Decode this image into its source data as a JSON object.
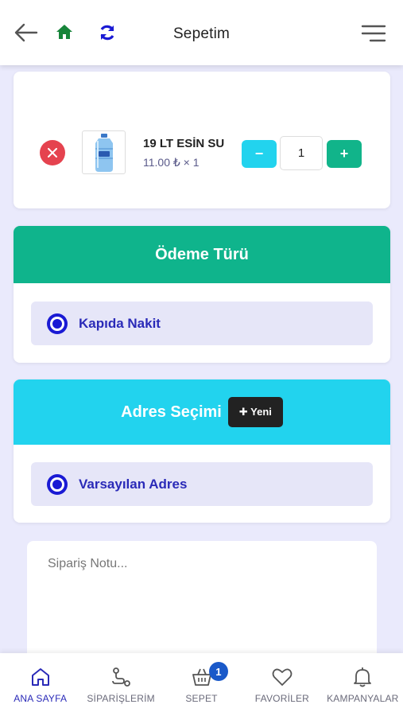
{
  "header": {
    "title": "Sepetim",
    "back_icon": "arrow-left-icon",
    "home_icon": "home-icon",
    "refresh_icon": "refresh-icon",
    "menu_icon": "menu-icon"
  },
  "cart": {
    "items": [
      {
        "name": "19 LT ESİN SU",
        "price_line": "11.00 ₺ × 1",
        "quantity": "1",
        "minus_label": "−",
        "plus_label": "+"
      }
    ]
  },
  "payment": {
    "title": "Ödeme Türü",
    "options": [
      {
        "label": "Kapıda Nakit",
        "selected": true
      }
    ]
  },
  "address": {
    "title": "Adres Seçimi",
    "new_button": "✚ Yeni",
    "options": [
      {
        "label": "Varsayılan Adres",
        "selected": true
      }
    ]
  },
  "note": {
    "placeholder": "Sipariş Notu..."
  },
  "bottom_nav": {
    "items": [
      {
        "label": "ANA SAYFA",
        "icon": "home-icon",
        "active": true
      },
      {
        "label": "SİPARİŞLERİM",
        "icon": "route-icon",
        "active": false
      },
      {
        "label": "SEPET",
        "icon": "basket-icon",
        "active": false,
        "badge": "1"
      },
      {
        "label": "FAVORİLER",
        "icon": "heart-icon",
        "active": false
      },
      {
        "label": "KAMPANYALAR",
        "icon": "bell-icon",
        "active": false
      }
    ]
  },
  "colors": {
    "background": "#eaeafc",
    "payment_header": "#0fb48c",
    "address_header": "#22d3ee",
    "remove": "#e5434f",
    "qty_minus": "#22d3ee",
    "qty_plus": "#11b48a",
    "accent": "#2a2ab8",
    "badge": "#1a59c9"
  }
}
